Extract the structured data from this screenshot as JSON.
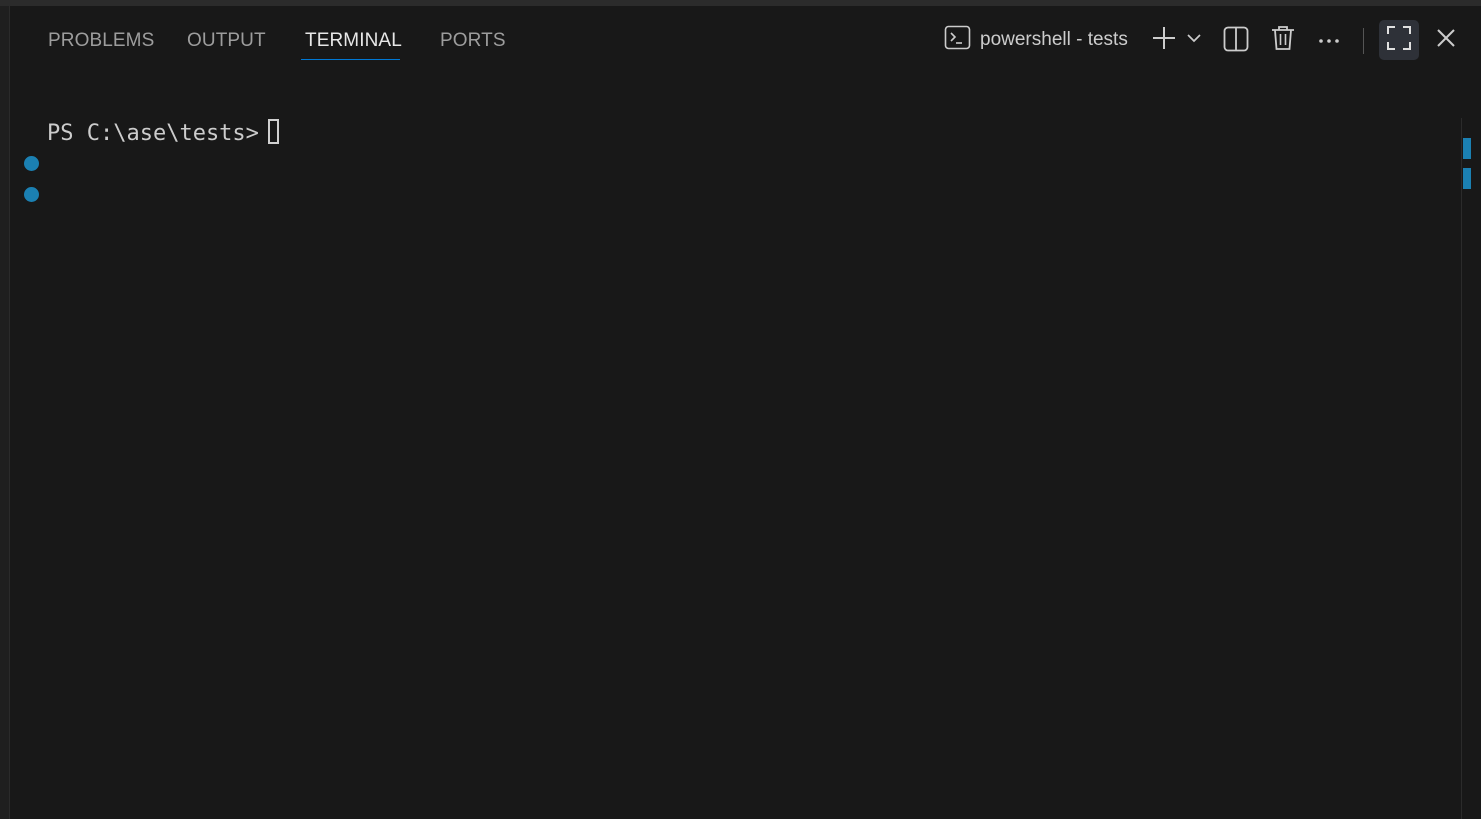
{
  "tabs": [
    {
      "label": "PROBLEMS",
      "active": false
    },
    {
      "label": "OUTPUT",
      "active": false
    },
    {
      "label": "TERMINAL",
      "active": true
    },
    {
      "label": "PORTS",
      "active": false
    }
  ],
  "toolbar": {
    "terminal_name": "powershell - tests",
    "terminal_icon": "terminal-icon",
    "new_terminal_icon": "plus-icon",
    "launch_profile_icon": "chevron-down-icon",
    "split_icon": "split-editor-icon",
    "kill_icon": "trash-icon",
    "more_icon": "ellipsis-icon",
    "maximize_icon": "maximize-icon",
    "close_icon": "close-icon"
  },
  "terminal": {
    "prompt": "PS C:\\ase\\tests> "
  },
  "colors": {
    "background": "#181818",
    "accent": "#0078d4",
    "decoration": "#1b80b2",
    "text": "#cccccc",
    "inactive_tab": "#9d9d9d"
  }
}
